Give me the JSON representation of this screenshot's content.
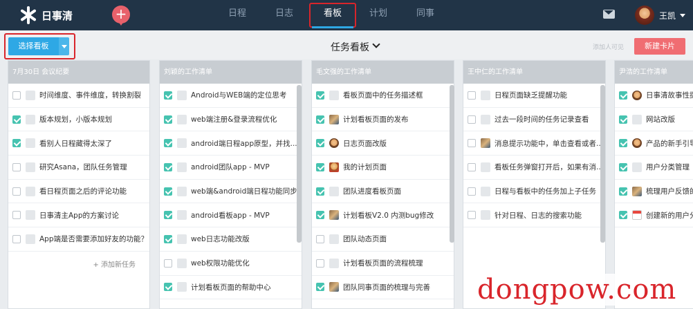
{
  "app": {
    "name": "日事清"
  },
  "nav": {
    "items": [
      {
        "label": "日程",
        "active": false
      },
      {
        "label": "日志",
        "active": false
      },
      {
        "label": "看板",
        "active": true
      },
      {
        "label": "计划",
        "active": false
      },
      {
        "label": "同事",
        "active": false
      }
    ]
  },
  "header": {
    "plus_label": "+",
    "user_name": "王凯"
  },
  "toolbar": {
    "select_board_label": "选择看板",
    "board_title": "任务看板",
    "add_member_label": "添加人可见",
    "new_card_label": "新建卡片"
  },
  "columns": [
    {
      "title": "7月30日 会议纪要",
      "add_task_label": "添加新任务",
      "tasks": [
        {
          "text": "时间维度、事件维度，转换割裂",
          "checked": false,
          "avatar": "blank"
        },
        {
          "text": "版本规划，小版本规划",
          "checked": true,
          "avatar": "blank"
        },
        {
          "text": "看别人日程藏得太深了",
          "checked": true,
          "avatar": "blank"
        },
        {
          "text": "研究Asana，团队任务管理",
          "checked": false,
          "avatar": "blank"
        },
        {
          "text": "看日程页面之后的评论功能",
          "checked": false,
          "avatar": "blank"
        },
        {
          "text": "日事清主App的方案讨论",
          "checked": false,
          "avatar": "blank"
        },
        {
          "text": "App端是否需要添加好友的功能？",
          "checked": false,
          "avatar": "blank"
        }
      ]
    },
    {
      "title": "刘颖的工作清单",
      "tasks": [
        {
          "text": "Android与WEB端的定位思考",
          "checked": true,
          "avatar": "blank"
        },
        {
          "text": "web端注册&登录流程优化",
          "checked": true,
          "avatar": "blank"
        },
        {
          "text": "android端日程app原型，并找...",
          "checked": true,
          "avatar": "blank"
        },
        {
          "text": "android团队app - MVP",
          "checked": true,
          "avatar": "blank"
        },
        {
          "text": "web端&android端日程功能同步",
          "checked": true,
          "avatar": "blank"
        },
        {
          "text": "android看板app - MVP",
          "checked": true,
          "avatar": "blank"
        },
        {
          "text": "web日志功能改版",
          "checked": true,
          "avatar": "blank"
        },
        {
          "text": "web权限功能优化",
          "checked": false,
          "avatar": "blank"
        },
        {
          "text": "计划看板页面的帮助中心",
          "checked": true,
          "avatar": "blank"
        }
      ]
    },
    {
      "title": "毛文强的工作清单",
      "tasks": [
        {
          "text": "看板页面中的任务描述框",
          "checked": true,
          "avatar": "blank"
        },
        {
          "text": "计划看板页面的发布",
          "checked": true,
          "avatar": "img"
        },
        {
          "text": "日志页面改版",
          "checked": true,
          "avatar": "face"
        },
        {
          "text": "我的计划页面",
          "checked": true,
          "avatar": "doll"
        },
        {
          "text": "团队进度看板页面",
          "checked": true,
          "avatar": "blank"
        },
        {
          "text": "计划看板V2.0 内测bug修改",
          "checked": true,
          "avatar": "img"
        },
        {
          "text": "团队动态页面",
          "checked": false,
          "avatar": "blank"
        },
        {
          "text": "计划看板页面的流程梳理",
          "checked": false,
          "avatar": "blank"
        },
        {
          "text": "团队同事页面的梳理与完善",
          "checked": true,
          "avatar": "img"
        }
      ]
    },
    {
      "title": "王中仁的工作清单",
      "tasks": [
        {
          "text": "日程页面缺乏提醒功能",
          "checked": false,
          "avatar": "blank"
        },
        {
          "text": "过去一段时间的任务记录查看",
          "checked": false,
          "avatar": "blank"
        },
        {
          "text": "消息提示功能中，单击查看或者...",
          "checked": false,
          "avatar": "img"
        },
        {
          "text": "看板任务弹窗打开后，如果有消...",
          "checked": false,
          "avatar": "blank"
        },
        {
          "text": "日程与看板中的任务加上子任务",
          "checked": false,
          "avatar": "blank"
        },
        {
          "text": "针对日程、日志的搜索功能",
          "checked": false,
          "avatar": "blank"
        }
      ]
    },
    {
      "title": "尹浩的工作清单",
      "tasks": [
        {
          "text": "日事清故事性提",
          "checked": true,
          "avatar": "face"
        },
        {
          "text": "网站改版",
          "checked": true,
          "avatar": "blank"
        },
        {
          "text": "产品的新手引导",
          "checked": true,
          "avatar": "face"
        },
        {
          "text": "用户分类管理",
          "checked": true,
          "avatar": "blank"
        },
        {
          "text": "梳理用户反馈的",
          "checked": true,
          "avatar": "img"
        },
        {
          "text": "创建新的用户分",
          "checked": true,
          "avatar": "cal"
        }
      ]
    }
  ],
  "watermark": "dongpow.com",
  "colors": {
    "topbar": "#213447",
    "accent_blue": "#2ea8e5",
    "new_card_red": "#f06d72",
    "check_green": "#46c3b0",
    "highlight_red": "#d9252b",
    "column_header": "#c8cdd2"
  }
}
